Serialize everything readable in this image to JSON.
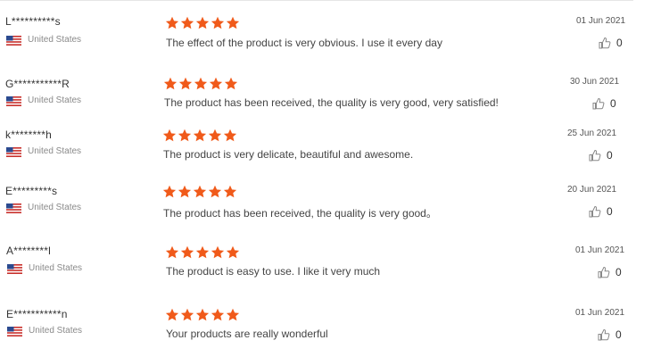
{
  "reviews": [
    {
      "name": "L**********s",
      "country": "United States",
      "comment": "The effect of the product is very obvious. I use it every day",
      "date": "01 Jun 2021",
      "likes": "0",
      "rating": 5
    },
    {
      "name": "G***********R",
      "country": "United States",
      "comment": "The product has been received, the quality is very good, very satisfied!",
      "date": "30 Jun 2021",
      "likes": "0",
      "rating": 5
    },
    {
      "name": "k********h",
      "country": "United States",
      "comment": "The product is very delicate, beautiful and awesome.",
      "date": "25 Jun 2021",
      "likes": "0",
      "rating": 5
    },
    {
      "name": "E*********s",
      "country": "United States",
      "comment": "The product has been received, the quality is very good。",
      "date": "20 Jun 2021",
      "likes": "0",
      "rating": 5
    },
    {
      "name": "A********l",
      "country": "United States",
      "comment": "The product is easy to use. I like it very much",
      "date": "01 Jun 2021",
      "likes": "0",
      "rating": 5
    },
    {
      "name": "E***********n",
      "country": "United States",
      "comment": "Your products are really wonderful",
      "date": "01 Jun 2021",
      "likes": "0",
      "rating": 5
    }
  ],
  "colors": {
    "star": "#f05a1a",
    "flag_red": "#c8302c",
    "flag_blue": "#2b4a8f"
  },
  "icons": {
    "flag": "us-flag-icon",
    "star": "star-icon",
    "like": "thumbs-up-icon"
  }
}
